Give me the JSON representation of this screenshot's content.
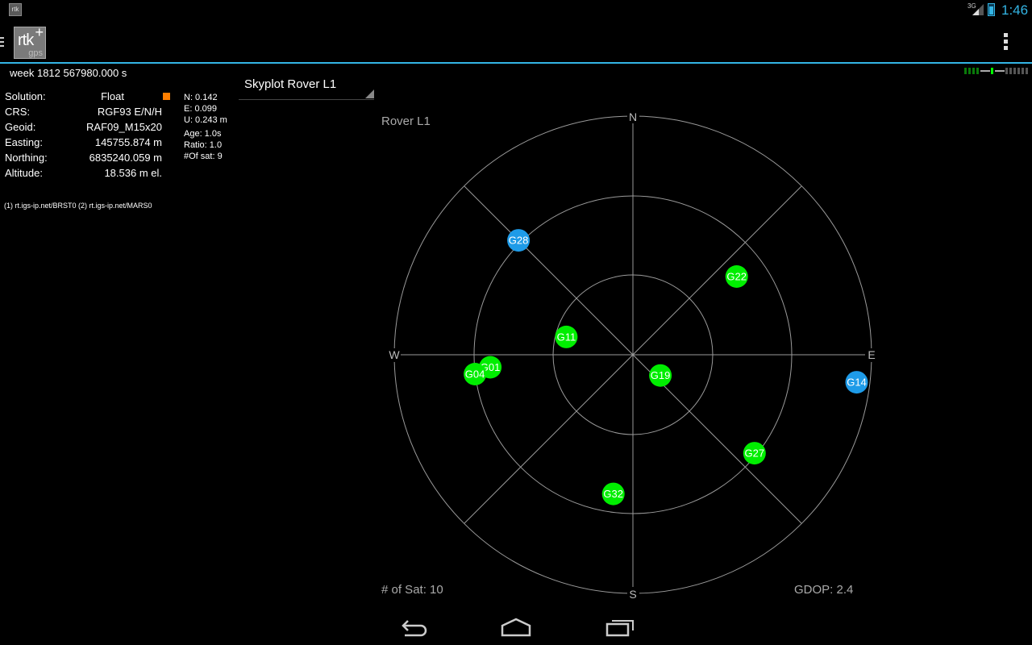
{
  "status_bar": {
    "app_icon": "rtk",
    "network": "3G",
    "signal_icon": "signal-icon",
    "battery_icon": "battery-charging-icon",
    "time": "1:46",
    "accent": "#33b5e5"
  },
  "action_bar": {
    "logo_main": "rtk",
    "logo_plus": "+",
    "logo_sub": "gps",
    "overflow_icon": "overflow-menu-icon"
  },
  "gps_time": "week 1812 567980.000 s",
  "solution": {
    "rows": [
      {
        "label": "Solution:",
        "value": "Float"
      },
      {
        "label": "CRS:",
        "value": "RGF93 E/N/H"
      },
      {
        "label": "Geoid:",
        "value": "RAF09_M15x20"
      },
      {
        "label": "Easting:",
        "value": "145755.874 m"
      },
      {
        "label": "Northing:",
        "value": "6835240.059 m"
      },
      {
        "label": "Altitude:",
        "value": "18.536 m el."
      }
    ],
    "float_color": "#ff7f00"
  },
  "precision": {
    "n": "N: 0.142",
    "e": "E: 0.099",
    "u": "U: 0.243 m",
    "age": "Age: 1.0s",
    "ratio": "Ratio: 1.0",
    "nsat": "#Of sat: 9"
  },
  "streams": "(1) rt.igs-ip.net/BRST0 (2) rt.igs-ip.net/MARS0",
  "spinner": {
    "selected": "Skyplot Rover L1"
  },
  "skyplot": {
    "title": "Rover L1",
    "directions": {
      "n": "N",
      "e": "E",
      "s": "S",
      "w": "W"
    },
    "num_sat": "# of Sat: 10",
    "gdop": "GDOP: 2.4",
    "colors": {
      "valid": "#00ee00",
      "other": "#1e9be8",
      "grid": "#9a9a9a"
    },
    "satellites": [
      {
        "id": "G28",
        "azimuth": 315,
        "elevation": 29,
        "color": "blue"
      },
      {
        "id": "G22",
        "azimuth": 53,
        "elevation": 41,
        "color": "green"
      },
      {
        "id": "G11",
        "azimuth": 285,
        "elevation": 64,
        "color": "green"
      },
      {
        "id": "G01",
        "azimuth": 265,
        "elevation": 36,
        "color": "green"
      },
      {
        "id": "G04",
        "azimuth": 263,
        "elevation": 30,
        "color": "green"
      },
      {
        "id": "G19",
        "azimuth": 127,
        "elevation": 77,
        "color": "green"
      },
      {
        "id": "G14",
        "azimuth": 97,
        "elevation": 5,
        "color": "blue"
      },
      {
        "id": "G27",
        "azimuth": 129,
        "elevation": 31,
        "color": "green"
      },
      {
        "id": "G32",
        "azimuth": 188,
        "elevation": 37,
        "color": "green"
      }
    ]
  },
  "nav_bar": {
    "back_icon": "back-icon",
    "home_icon": "home-icon",
    "recents_icon": "recent-apps-icon"
  }
}
